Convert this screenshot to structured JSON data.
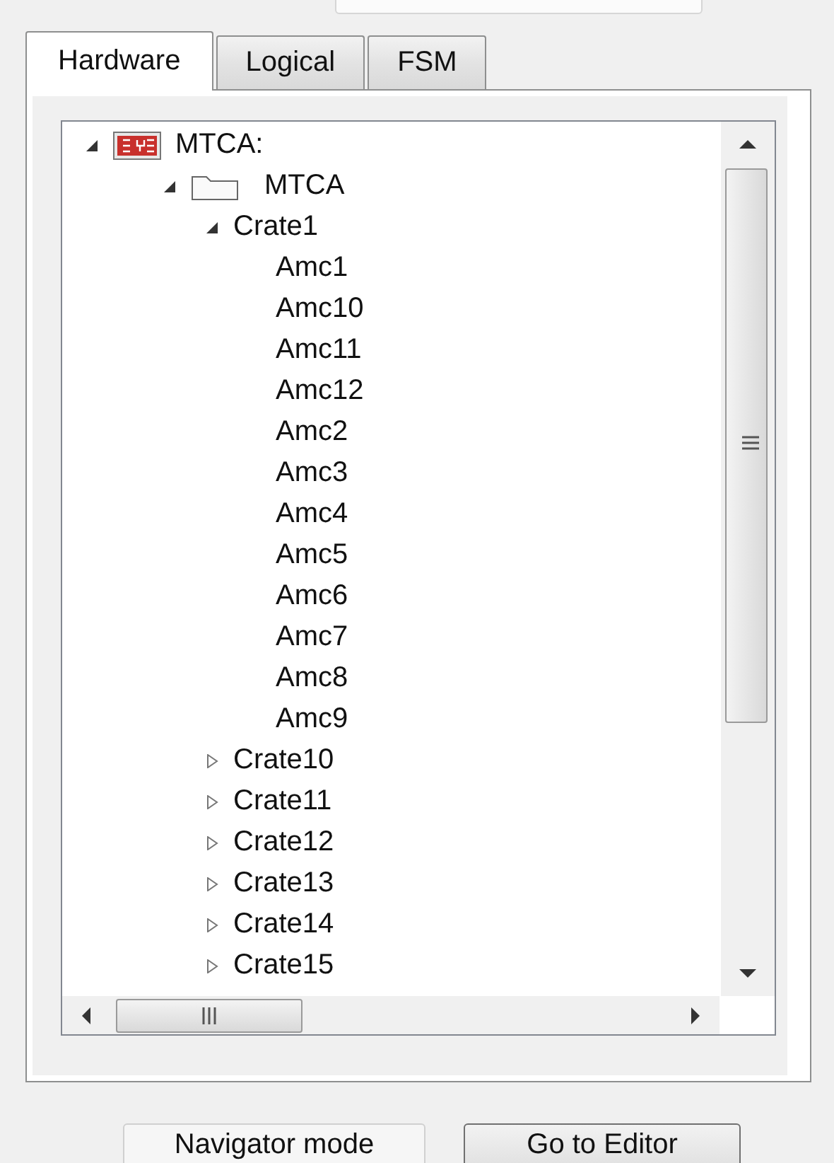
{
  "tabs": [
    {
      "label": "Hardware",
      "selected": true
    },
    {
      "label": "Logical",
      "selected": false
    },
    {
      "label": "FSM",
      "selected": false
    }
  ],
  "tree": [
    {
      "label": "MTCA:",
      "kind": "system",
      "expanded": true,
      "children": [
        {
          "label": "MTCA",
          "kind": "folder",
          "expanded": true,
          "children": [
            {
              "label": "Crate1",
              "expanded": true,
              "children": [
                {
                  "label": "Amc1"
                },
                {
                  "label": "Amc10"
                },
                {
                  "label": "Amc11"
                },
                {
                  "label": "Amc12"
                },
                {
                  "label": "Amc2"
                },
                {
                  "label": "Amc3"
                },
                {
                  "label": "Amc4"
                },
                {
                  "label": "Amc5"
                },
                {
                  "label": "Amc6"
                },
                {
                  "label": "Amc7"
                },
                {
                  "label": "Amc8"
                },
                {
                  "label": "Amc9"
                }
              ]
            },
            {
              "label": "Crate10",
              "expanded": false
            },
            {
              "label": "Crate11",
              "expanded": false
            },
            {
              "label": "Crate12",
              "expanded": false
            },
            {
              "label": "Crate13",
              "expanded": false
            },
            {
              "label": "Crate14",
              "expanded": false
            },
            {
              "label": "Crate15",
              "expanded": false
            }
          ]
        }
      ]
    }
  ],
  "buttons": [
    "Navigator mode",
    "Go to Editor"
  ]
}
